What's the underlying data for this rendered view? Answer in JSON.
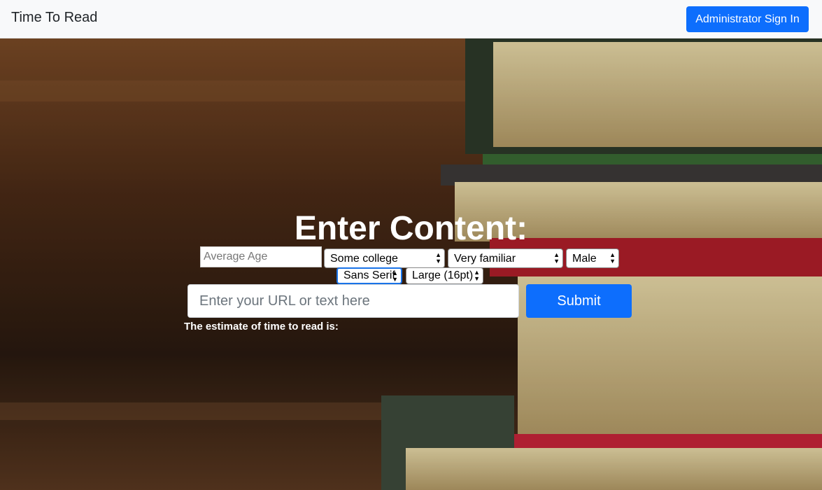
{
  "navbar": {
    "brand": "Time To Read",
    "signin_label": "Administrator Sign In",
    "signin_color": "#0d6efd"
  },
  "hero": {
    "background": "stack of old books on a wooden table",
    "title": "Enter Content:"
  },
  "form": {
    "age_placeholder": "Average Age",
    "education": "Some college",
    "familiarity": "Very familiar",
    "gender": "Male",
    "font": "Sans Serif",
    "font_size": "Large (16pt)",
    "url_placeholder": "Enter your URL or text here",
    "submit_label": "Submit",
    "submit_color": "#0d6efd",
    "estimate_label": "The estimate of time to read is:"
  },
  "icons": [
    "select-arrows-icon"
  ]
}
